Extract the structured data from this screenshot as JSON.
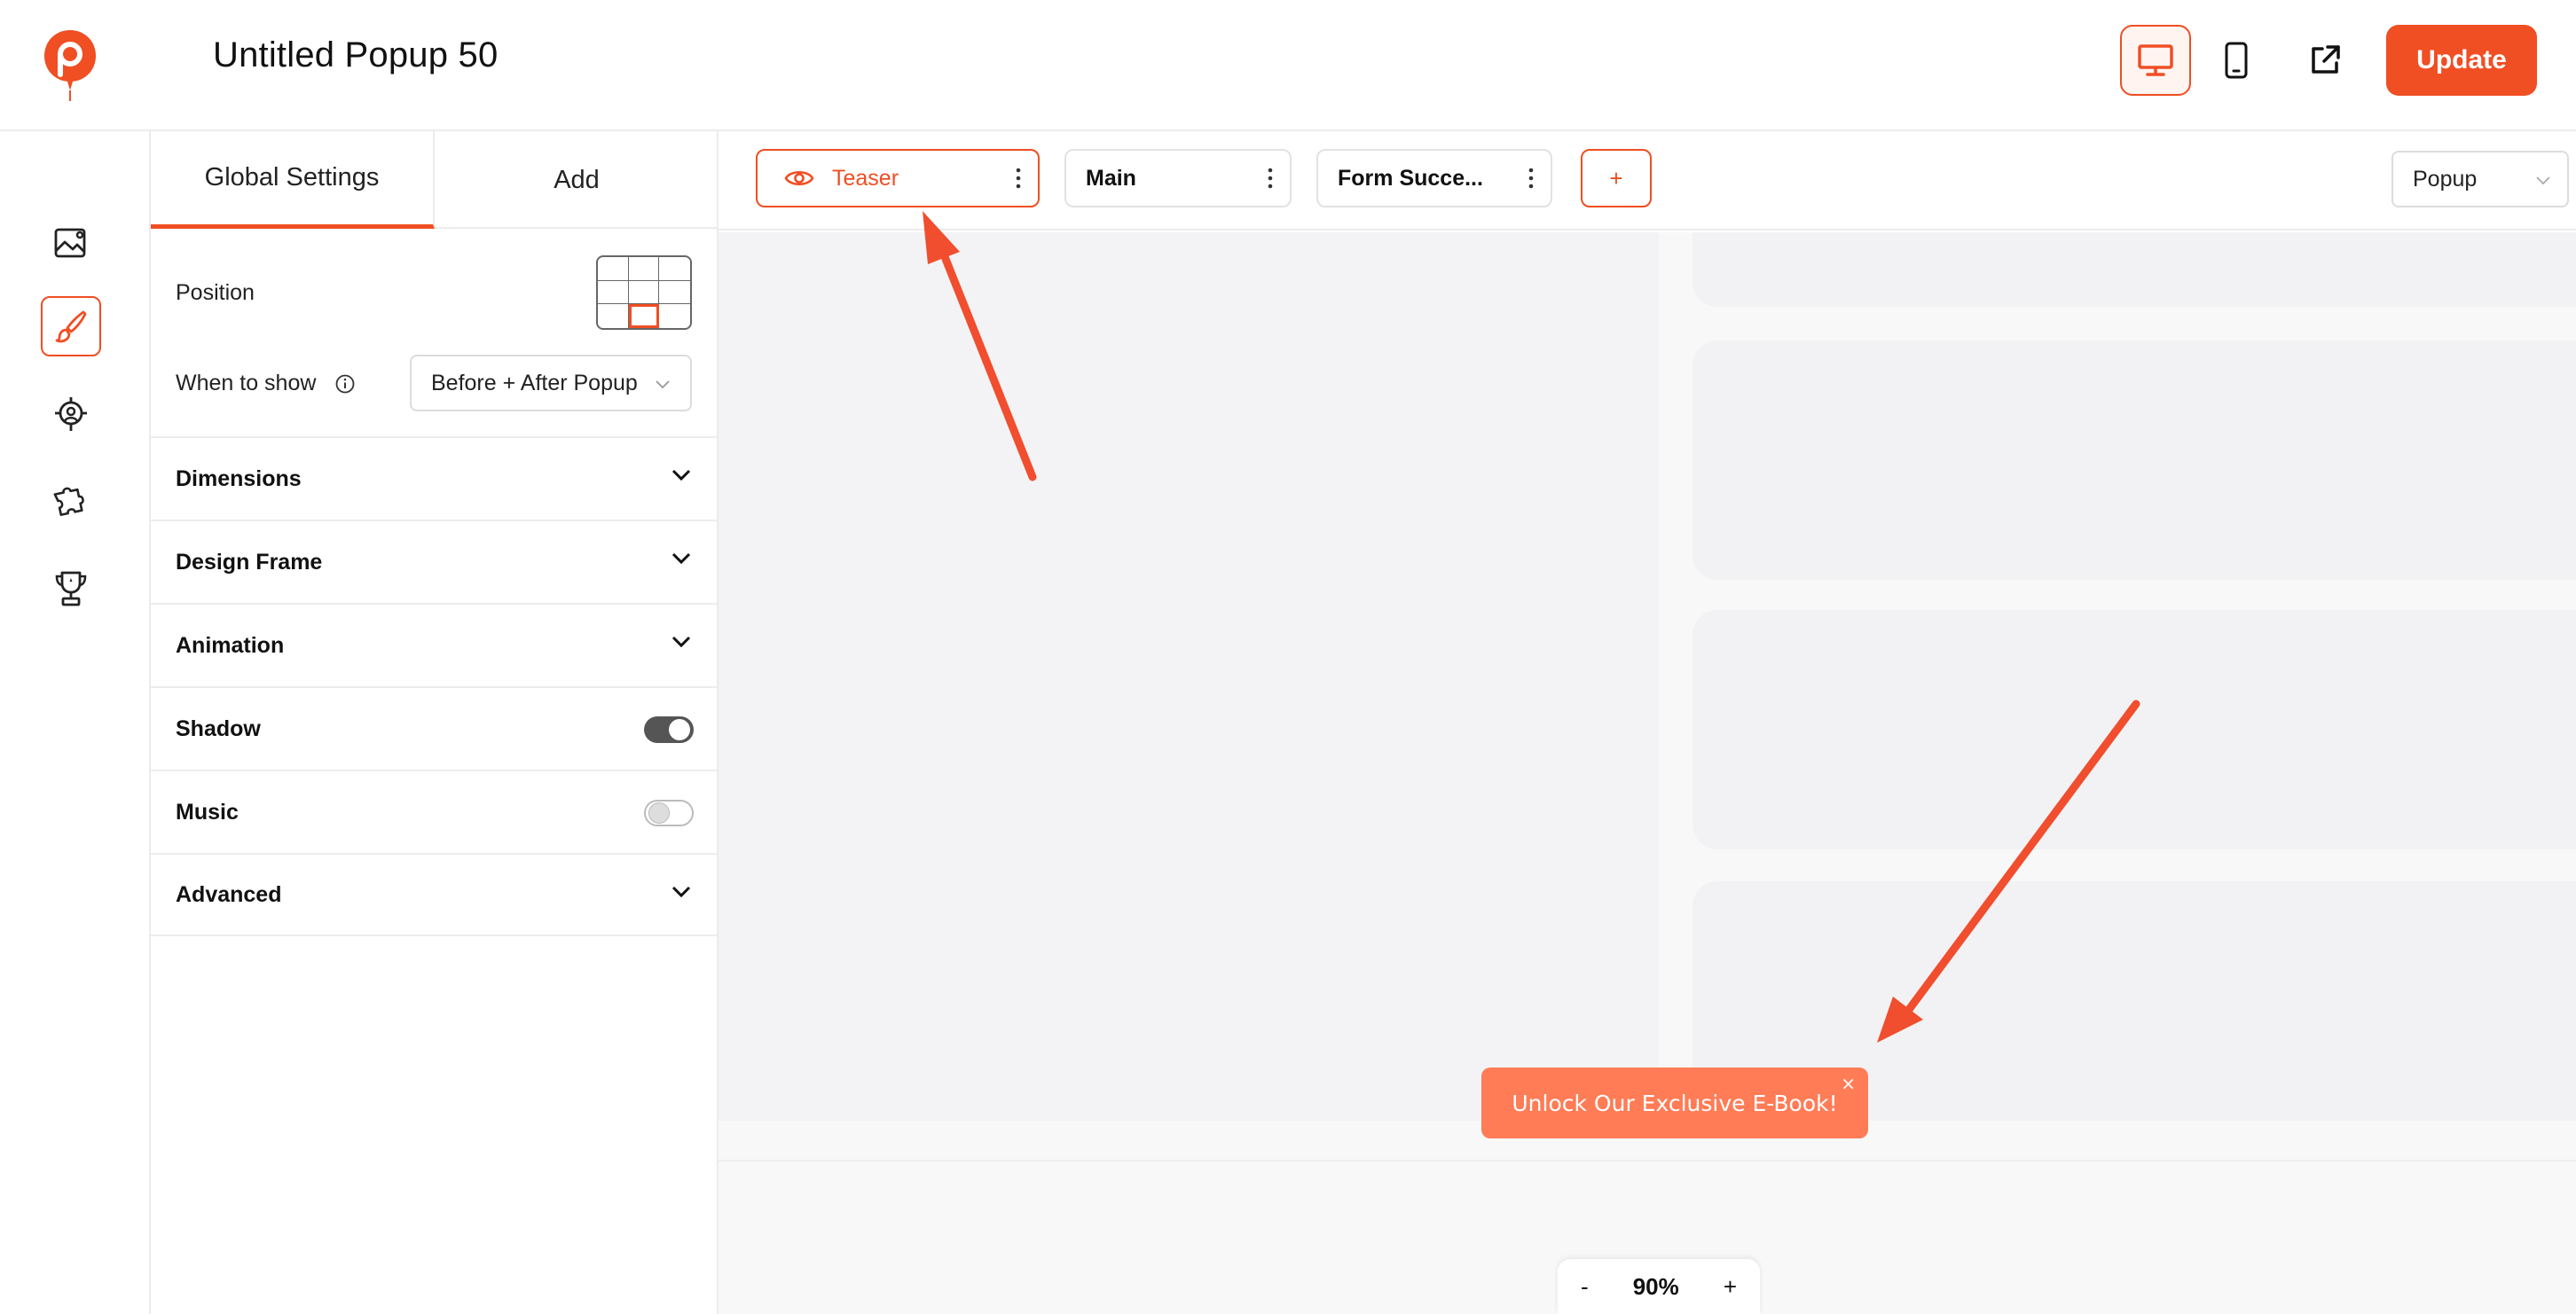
{
  "header": {
    "title": "Untitled Popup 50",
    "update_label": "Update",
    "icons": [
      "logo-icon",
      "desktop-icon",
      "mobile-icon",
      "external-link-icon"
    ]
  },
  "rail": {
    "items": [
      {
        "name": "image-icon",
        "active": false
      },
      {
        "name": "brush-icon",
        "active": true
      },
      {
        "name": "target-icon",
        "active": false
      },
      {
        "name": "puzzle-icon",
        "active": false
      },
      {
        "name": "trophy-icon",
        "active": false
      }
    ]
  },
  "panel": {
    "tabs": [
      {
        "label": "Global Settings",
        "active": true
      },
      {
        "label": "Add",
        "active": false
      }
    ],
    "position_label": "Position",
    "when_label": "When to show",
    "when_value": "Before + After Popup",
    "sections": [
      {
        "label": "Dimensions",
        "control": "chevron"
      },
      {
        "label": "Design Frame",
        "control": "chevron"
      },
      {
        "label": "Animation",
        "control": "chevron"
      },
      {
        "label": "Shadow",
        "control": "toggle",
        "on": true
      },
      {
        "label": "Music",
        "control": "toggle",
        "on": false
      },
      {
        "label": "Advanced",
        "control": "chevron"
      }
    ]
  },
  "steps": {
    "teaser": "Teaser",
    "main": "Main",
    "success": "Form Succe...",
    "add": "+",
    "type_value": "Popup"
  },
  "teaser_popup": {
    "text": "Unlock Our Exclusive E-Book!",
    "close": "×"
  },
  "zoom": {
    "minus": "-",
    "value": "90%",
    "plus": "+"
  },
  "colors": {
    "accent": "#f04e23",
    "teaser_bg": "#ff7c56",
    "annotation_arrow": "#f04e2e"
  }
}
